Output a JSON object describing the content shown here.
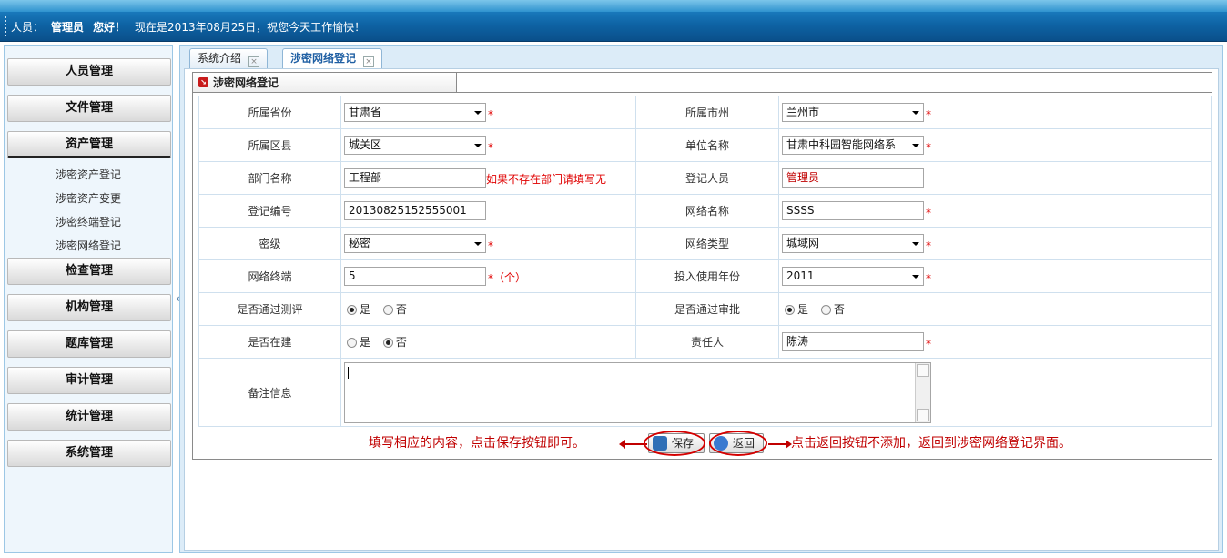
{
  "header": {
    "user_label": "人员：",
    "user_name": "管理员",
    "greeting": "您好！",
    "date_text": "现在是2013年08月25日，祝您今天工作愉快！"
  },
  "sidebar": {
    "items": [
      {
        "label": "人员管理"
      },
      {
        "label": "文件管理"
      },
      {
        "label": "资产管理"
      },
      {
        "label": "检查管理"
      },
      {
        "label": "机构管理"
      },
      {
        "label": "题库管理"
      },
      {
        "label": "审计管理"
      },
      {
        "label": "统计管理"
      },
      {
        "label": "系统管理"
      }
    ],
    "sub_items": [
      {
        "label": "涉密资产登记"
      },
      {
        "label": "涉密资产变更"
      },
      {
        "label": "涉密终端登记"
      },
      {
        "label": "涉密网络登记"
      }
    ],
    "collapse_glyph": "«"
  },
  "tabs": [
    {
      "label": "系统介绍",
      "close": "×"
    },
    {
      "label": "涉密网络登记",
      "close": "×"
    }
  ],
  "panel": {
    "title": "涉密网络登记",
    "icon": "arrow-right-icon"
  },
  "form": {
    "province": {
      "label": "所属省份",
      "value": "甘肃省"
    },
    "city": {
      "label": "所属市州",
      "value": "兰州市"
    },
    "district": {
      "label": "所属区县",
      "value": "城关区"
    },
    "unit": {
      "label": "单位名称",
      "value": "甘肃中科园智能网络系"
    },
    "department": {
      "label": "部门名称",
      "value": "工程部",
      "note": "如果不存在部门请填写无"
    },
    "registrar": {
      "label": "登记人员",
      "value": "管理员"
    },
    "reg_no": {
      "label": "登记编号",
      "value": "20130825152555001"
    },
    "network_name": {
      "label": "网络名称",
      "value": "SSSS"
    },
    "security_level": {
      "label": "密级",
      "value": "秘密"
    },
    "network_type": {
      "label": "网络类型",
      "value": "城域网"
    },
    "terminals": {
      "label": "网络终端",
      "value": "5",
      "unit": "（个）"
    },
    "year_in_use": {
      "label": "投入使用年份",
      "value": "2011"
    },
    "evaluated": {
      "label": "是否通过测评",
      "yes": "是",
      "no": "否",
      "selected": "yes"
    },
    "approved": {
      "label": "是否通过审批",
      "yes": "是",
      "no": "否",
      "selected": "yes"
    },
    "under_construction": {
      "label": "是否在建",
      "yes": "是",
      "no": "否",
      "selected": "no"
    },
    "responsible": {
      "label": "责任人",
      "value": "陈涛"
    },
    "remark": {
      "label": "备注信息",
      "value": ""
    },
    "required_mark": "*"
  },
  "actions": {
    "save_label": "保存",
    "back_label": "返回",
    "hint_left": "填写相应的内容，点击保存按钮即可。",
    "hint_right": "点击返回按钮不添加，返回到涉密网络登记界面。"
  },
  "colors": {
    "header_blue": "#0e63a4",
    "required_red": "#e00000",
    "annotation_red": "#c00000"
  }
}
